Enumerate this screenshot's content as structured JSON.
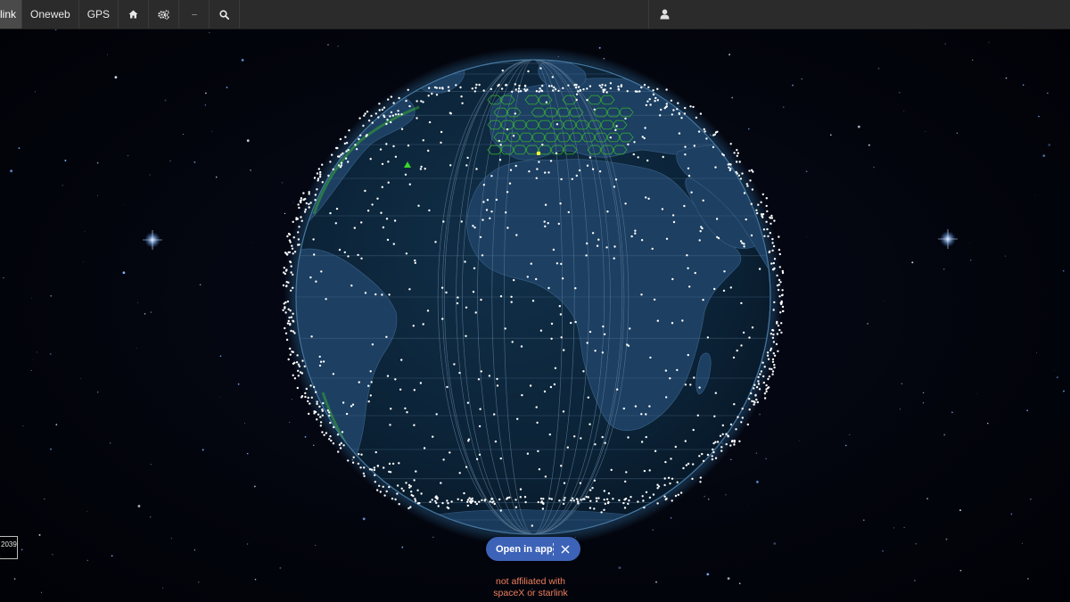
{
  "nav": {
    "active_label": "link",
    "oneweb_label": "Oneweb",
    "gps_label": "GPS",
    "more_label": "···"
  },
  "icons": {
    "home": "home-icon",
    "settings": "gears-icon",
    "search": "search-icon",
    "user": "user-icon",
    "close": "close-icon"
  },
  "open_app": {
    "label": "Open in app"
  },
  "disclaimer": {
    "line1": "not affiliated with",
    "line2": "spaceX or starlink"
  },
  "year_box": {
    "value": "2039"
  },
  "colors": {
    "topbar": "#2b2b2b",
    "ocean": "#0d2338",
    "land": "#1c3f62",
    "satellite": "#ffffff",
    "coverage": "#3bbf2a",
    "open_app_button": "#3d63b8",
    "disclaimer_text": "#ef7f5d"
  }
}
